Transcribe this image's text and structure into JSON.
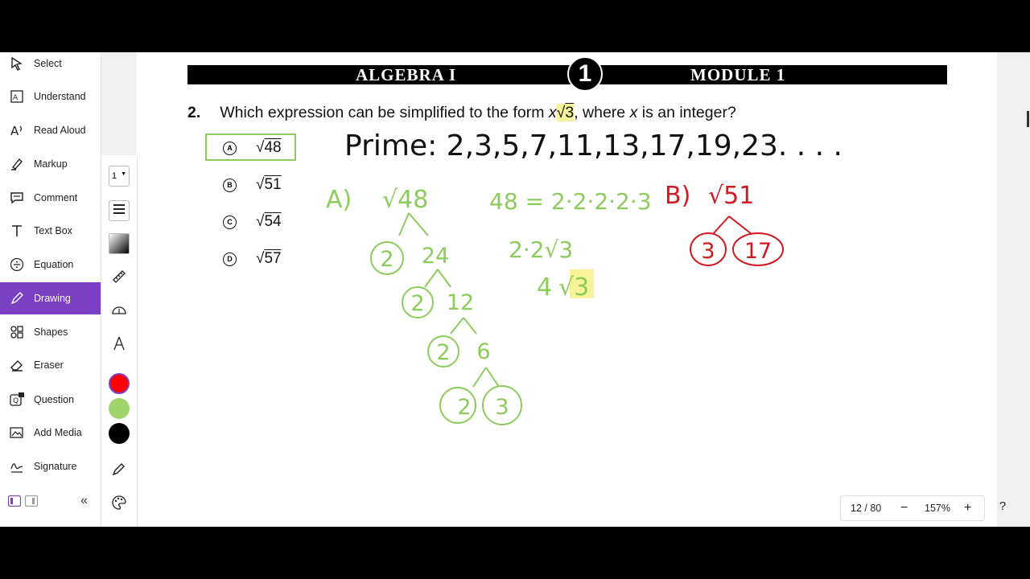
{
  "sidebar": {
    "items": [
      {
        "label": "Select",
        "icon": "cursor-icon"
      },
      {
        "label": "Understand",
        "icon": "understand-icon"
      },
      {
        "label": "Read Aloud",
        "icon": "read-aloud-icon"
      },
      {
        "label": "Markup",
        "icon": "highlighter-icon"
      },
      {
        "label": "Comment",
        "icon": "comment-icon"
      },
      {
        "label": "Text Box",
        "icon": "text-icon"
      },
      {
        "label": "Equation",
        "icon": "divide-icon"
      },
      {
        "label": "Drawing",
        "icon": "pen-icon"
      },
      {
        "label": "Shapes",
        "icon": "shapes-icon"
      },
      {
        "label": "Eraser",
        "icon": "eraser-icon"
      },
      {
        "label": "Question",
        "icon": "question-ai-icon"
      },
      {
        "label": "Add Media",
        "icon": "media-icon"
      },
      {
        "label": "Signature",
        "icon": "signature-icon"
      }
    ],
    "active": "Drawing",
    "accent": "#7b3fc4"
  },
  "subbar": {
    "stroke_size": "1",
    "colors": [
      "#ff0000",
      "#9ed66b",
      "#000000"
    ]
  },
  "page": {
    "header_left": "ALGEBRA I",
    "header_badge": "1",
    "header_right": "MODULE 1",
    "question_number": "2.",
    "question_pre": "Which expression can be simplified to the form ",
    "question_var": "x",
    "question_root_sym": "√",
    "question_root": "3",
    "question_mid": ", where ",
    "question_var2": "x",
    "question_post": " is an integer?",
    "choices": [
      {
        "letter": "A",
        "radicand": "48"
      },
      {
        "letter": "B",
        "radicand": "51"
      },
      {
        "letter": "C",
        "radicand": "54"
      },
      {
        "letter": "D",
        "radicand": "57"
      }
    ],
    "selected": "A"
  },
  "handwriting": {
    "primes": "Prime: 2,3,5,7,11,13,17,19,23. . . .",
    "a_label": "A)",
    "a_root": "√48",
    "a_eq": "48 = 2·2·2·2·3",
    "a_step": "2·2√3",
    "a_result_coef": "4",
    "a_result_root": "√3",
    "b_label": "B)",
    "b_root": "√51",
    "tree": [
      "2",
      "24",
      "2",
      "12",
      "2",
      "6",
      "2",
      "3"
    ],
    "b_tree": [
      "3",
      "17"
    ]
  },
  "zoom": {
    "page_indicator": "12 / 80",
    "minus": "−",
    "level": "157%",
    "plus": "+",
    "help": "?"
  }
}
